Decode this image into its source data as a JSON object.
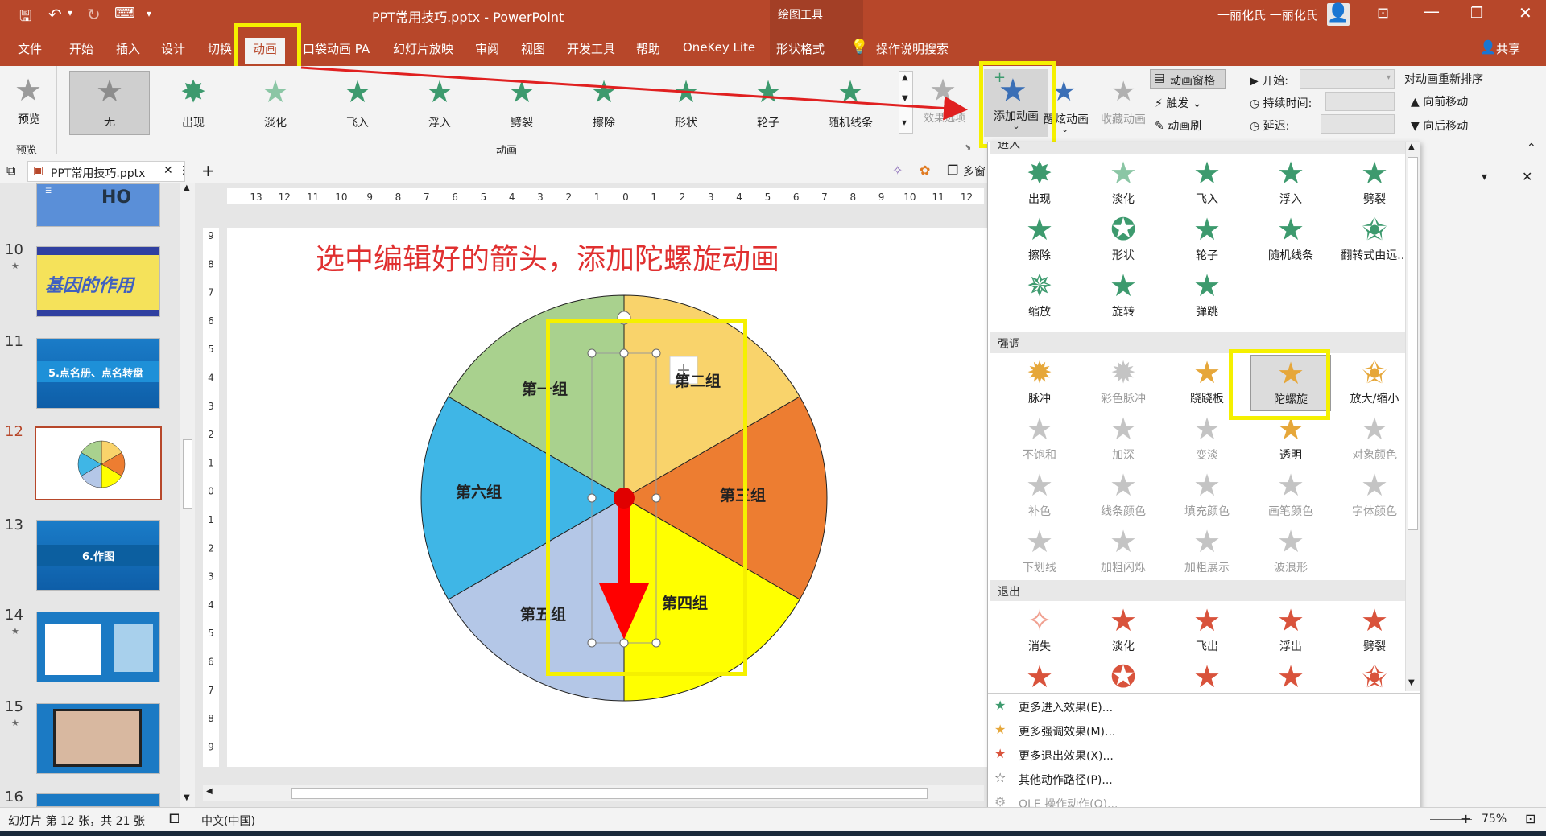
{
  "app": {
    "title": "PPT常用技巧.pptx  -  PowerPoint",
    "context_tab": "绘图工具",
    "user": "一丽化氏 一丽化氏",
    "share": "共享"
  },
  "tabs": [
    "文件",
    "开始",
    "插入",
    "设计",
    "切换",
    "动画",
    "口袋动画 PA",
    "幻灯片放映",
    "审阅",
    "视图",
    "开发工具",
    "帮助",
    "OneKey Lite",
    "形状格式"
  ],
  "tell_me": "操作说明搜索",
  "ribbon": {
    "preview": "预览",
    "preview_group": "预览",
    "animation_group": "动画",
    "gallery": [
      "无",
      "出现",
      "淡化",
      "飞入",
      "浮入",
      "劈裂",
      "擦除",
      "形状",
      "轮子",
      "随机线条"
    ],
    "effect_options": "效果选项",
    "add_animation": "添加动画",
    "animation_pane": "动画窗格",
    "trigger": "触发",
    "animation_painter": "动画刷",
    "start": "开始:",
    "duration": "持续时间:",
    "delay": "延迟:",
    "reorder": "对动画重新排序",
    "move_earlier": "向前移动",
    "move_later": "向后移动",
    "peek_add": "醒",
    "peek_add2": "炫动画",
    "peek_fav": "收藏动画"
  },
  "doc_tab": "PPT常用技巧.pptx",
  "view_btn": "多窗",
  "thumbnails": [
    {
      "num": "10",
      "star": "★",
      "text": "基因的作用"
    },
    {
      "num": "11",
      "star": "",
      "text": "5.点名册、点名转盘"
    },
    {
      "num": "12",
      "star": "",
      "text": ""
    },
    {
      "num": "13",
      "star": "",
      "text": "6.作图"
    },
    {
      "num": "14",
      "star": "★",
      "text": ""
    },
    {
      "num": "15",
      "star": "★",
      "text": ""
    },
    {
      "num": "16",
      "star": "",
      "text": ""
    }
  ],
  "slide": {
    "title": "选中编辑好的箭头，添加陀螺旋动画",
    "segments": [
      "第一组",
      "第二组",
      "第三组",
      "第四组",
      "第五组",
      "第六组"
    ]
  },
  "dropdown": {
    "sections": [
      "进入",
      "强调",
      "退出"
    ],
    "entrance": [
      "出现",
      "淡化",
      "飞入",
      "浮入",
      "劈裂",
      "擦除",
      "形状",
      "轮子",
      "随机线条",
      "翻转式由远...",
      "缩放",
      "旋转",
      "弹跳"
    ],
    "emphasis": [
      "脉冲",
      "彩色脉冲",
      "跷跷板",
      "陀螺旋",
      "放大/缩小",
      "不饱和",
      "加深",
      "变淡",
      "透明",
      "对象颜色",
      "补色",
      "线条颜色",
      "填充颜色",
      "画笔颜色",
      "字体颜色",
      "下划线",
      "加粗闪烁",
      "加粗展示",
      "波浪形"
    ],
    "exit": [
      "消失",
      "淡化",
      "飞出",
      "浮出",
      "劈裂"
    ],
    "more": [
      "更多进入效果(E)...",
      "更多强调效果(M)...",
      "更多退出效果(X)...",
      "其他动作路径(P)...",
      "OLE 操作动作(O)..."
    ]
  },
  "status": {
    "slide_info": "幻灯片 第 12 张，共 21 张",
    "lang": "中文(中国)",
    "zoom": "75%"
  },
  "colors": {
    "accent": "#b7472a",
    "highlight": "#f5f000",
    "annotation_arrow": "#e02020",
    "entrance_star": "#3d9a6e",
    "emphasis_star": "#e6a73a",
    "exit_star": "#d9533c"
  }
}
